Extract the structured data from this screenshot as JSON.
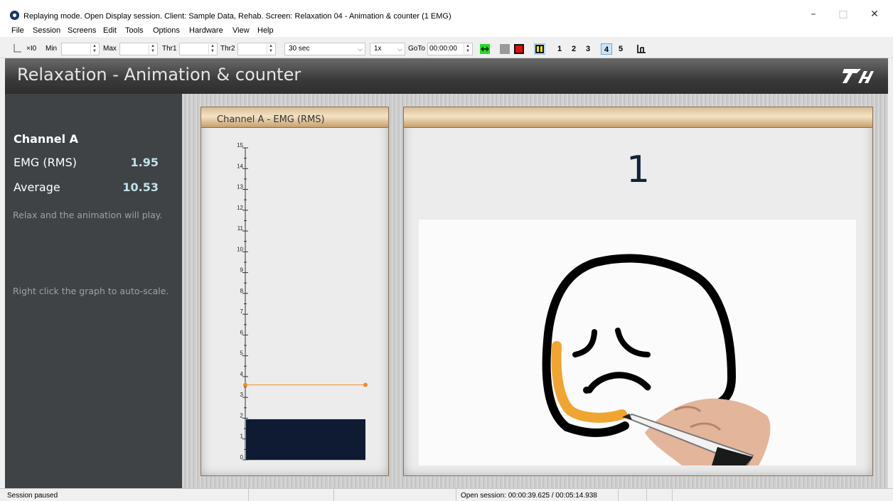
{
  "window": {
    "title": "Replaying mode. Open Display session. Client: Sample Data, Rehab. Screen: Relaxation 04 - Animation & counter (1 EMG)",
    "minimize_glyph": "–",
    "maximize_glyph": "□",
    "close_glyph": "✕"
  },
  "menu": [
    "File",
    "Session",
    "Screens",
    "Edit",
    "Tools",
    "Options",
    "Hardware",
    "View",
    "Help"
  ],
  "toolbar": {
    "zoom_label": "×I0",
    "min_label": "Min",
    "max_label": "Max",
    "thr1_label": "Thr1",
    "thr2_label": "Thr2",
    "timebase": "30 sec",
    "speed": "1x",
    "goto_label": "GoTo",
    "goto_value": "00:00:00",
    "screen_numbers": [
      "1",
      "2",
      "3",
      "4",
      "5"
    ],
    "active_screen": "4"
  },
  "header": {
    "title": "Relaxation - Animation & counter"
  },
  "left_panel": {
    "channel_title": "Channel A",
    "rows": [
      {
        "label": "EMG (RMS)",
        "value": "1.95"
      },
      {
        "label": "Average",
        "value": "10.53"
      }
    ],
    "hint_relax": "Relax and the animation will play.",
    "hint_autoscale": "Right click the graph to auto-scale."
  },
  "graph_panel": {
    "title": "Channel A - EMG (RMS)"
  },
  "chart_data": {
    "type": "bar",
    "values": [
      1.95
    ],
    "ylim": [
      0,
      15
    ],
    "yticks": [
      "0",
      "1",
      "2",
      "3",
      "4",
      "5",
      "6",
      "7",
      "8",
      "9",
      "10",
      "11",
      "12",
      "13",
      "14",
      "15"
    ],
    "threshold": 3.6,
    "bar_color": "#0f1b33",
    "threshold_color": "#f08c1e"
  },
  "counter_panel": {
    "count": "1"
  },
  "status": {
    "left": "Session paused",
    "center": "Open session: 00:00:39.625 / 00:05:14.938"
  },
  "colors": {
    "accent_green": "#22dd22",
    "stop_red": "#e01010",
    "pause_yellow": "#f2e600",
    "active_tab": "#cce4f7"
  }
}
